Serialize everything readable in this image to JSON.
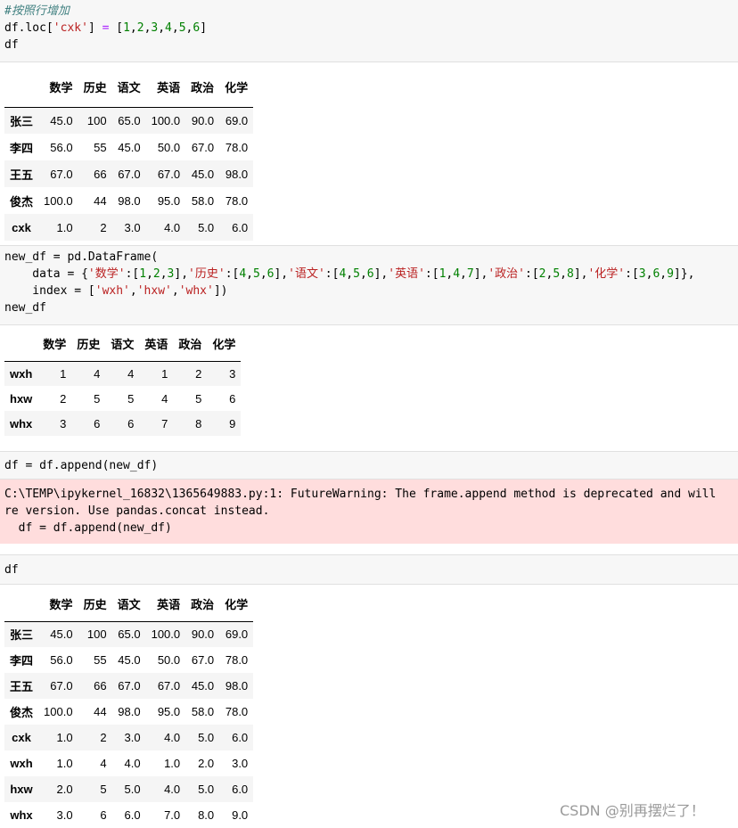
{
  "cells": {
    "cell1": {
      "comment": "#按照行增加",
      "line2": {
        "a": "df.loc[",
        "b": "'cxk'",
        "c": "] ",
        "d": "=",
        "e": " [",
        "n": [
          "1",
          "2",
          "3",
          "4",
          "5",
          "6"
        ],
        "f": "]"
      },
      "line3": "df"
    },
    "cell2": {
      "line1": "new_df = pd.DataFrame(",
      "line2": {
        "prefix": "    data = {",
        "pairs": [
          {
            "k": "'数学'",
            "v": [
              "1",
              "2",
              "3"
            ]
          },
          {
            "k": "'历史'",
            "v": [
              "4",
              "5",
              "6"
            ]
          },
          {
            "k": "'语文'",
            "v": [
              "4",
              "5",
              "6"
            ]
          },
          {
            "k": "'英语'",
            "v": [
              "1",
              "4",
              "7"
            ]
          },
          {
            "k": "'政治'",
            "v": [
              "2",
              "5",
              "8"
            ]
          },
          {
            "k": "'化学'",
            "v": [
              "3",
              "6",
              "9"
            ]
          }
        ],
        "suffix": "},"
      },
      "line3": {
        "prefix": "    index = [",
        "items": [
          "'wxh'",
          "'hxw'",
          "'whx'"
        ],
        "suffix": "])"
      },
      "line4": "new_df"
    },
    "cell3": {
      "line1": "df = df.append(new_df)"
    },
    "warning": {
      "line1": "C:\\TEMP\\ipykernel_16832\\1365649883.py:1: FutureWarning: The frame.append method is deprecated and will",
      "line2": "re version. Use pandas.concat instead.",
      "line3": "  df = df.append(new_df)"
    },
    "cell4": {
      "line1": "df"
    }
  },
  "tables": {
    "columns": [
      "数学",
      "历史",
      "语文",
      "英语",
      "政治",
      "化学"
    ],
    "df1": [
      {
        "index": "张三",
        "values": [
          "45.0",
          "100",
          "65.0",
          "100.0",
          "90.0",
          "69.0"
        ]
      },
      {
        "index": "李四",
        "values": [
          "56.0",
          "55",
          "45.0",
          "50.0",
          "67.0",
          "78.0"
        ]
      },
      {
        "index": "王五",
        "values": [
          "67.0",
          "66",
          "67.0",
          "67.0",
          "45.0",
          "98.0"
        ]
      },
      {
        "index": "俊杰",
        "values": [
          "100.0",
          "44",
          "98.0",
          "95.0",
          "58.0",
          "78.0"
        ]
      },
      {
        "index": "cxk",
        "values": [
          "1.0",
          "2",
          "3.0",
          "4.0",
          "5.0",
          "6.0"
        ]
      }
    ],
    "new_df": [
      {
        "index": "wxh",
        "values": [
          "1",
          "4",
          "4",
          "1",
          "2",
          "3"
        ]
      },
      {
        "index": "hxw",
        "values": [
          "2",
          "5",
          "5",
          "4",
          "5",
          "6"
        ]
      },
      {
        "index": "whx",
        "values": [
          "3",
          "6",
          "6",
          "7",
          "8",
          "9"
        ]
      }
    ],
    "df2": [
      {
        "index": "张三",
        "values": [
          "45.0",
          "100",
          "65.0",
          "100.0",
          "90.0",
          "69.0"
        ]
      },
      {
        "index": "李四",
        "values": [
          "56.0",
          "55",
          "45.0",
          "50.0",
          "67.0",
          "78.0"
        ]
      },
      {
        "index": "王五",
        "values": [
          "67.0",
          "66",
          "67.0",
          "67.0",
          "45.0",
          "98.0"
        ]
      },
      {
        "index": "俊杰",
        "values": [
          "100.0",
          "44",
          "98.0",
          "95.0",
          "58.0",
          "78.0"
        ]
      },
      {
        "index": "cxk",
        "values": [
          "1.0",
          "2",
          "3.0",
          "4.0",
          "5.0",
          "6.0"
        ]
      },
      {
        "index": "wxh",
        "values": [
          "1.0",
          "4",
          "4.0",
          "1.0",
          "2.0",
          "3.0"
        ]
      },
      {
        "index": "hxw",
        "values": [
          "2.0",
          "5",
          "5.0",
          "4.0",
          "5.0",
          "6.0"
        ]
      },
      {
        "index": "whx",
        "values": [
          "3.0",
          "6",
          "6.0",
          "7.0",
          "8.0",
          "9.0"
        ]
      }
    ]
  },
  "watermark": "CSDN @别再摆烂了！"
}
